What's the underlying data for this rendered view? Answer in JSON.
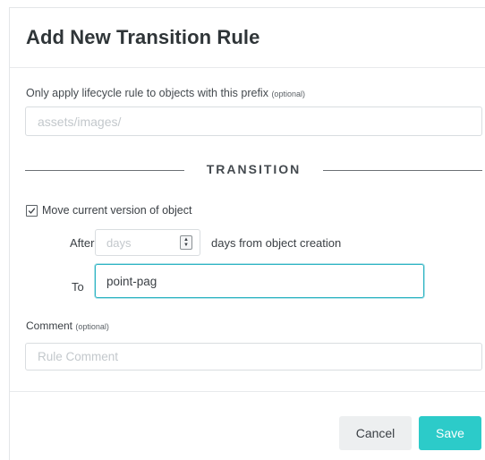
{
  "dialog": {
    "title": "Add New Transition Rule"
  },
  "prefix": {
    "label": "Only apply lifecycle rule to objects with this prefix",
    "optional_tag": "(optional)",
    "placeholder": "assets/images/",
    "value": ""
  },
  "section": {
    "transition_heading": "TRANSITION"
  },
  "move_current": {
    "checked": true,
    "label": "Move current version of object"
  },
  "after": {
    "label": "After",
    "placeholder": "days",
    "suffix": "days from object creation",
    "stepper_icon": "up-down-stepper-icon"
  },
  "to": {
    "label": "To",
    "value": "point-pag"
  },
  "comment": {
    "label": "Comment",
    "optional_tag": "(optional)",
    "placeholder": "Rule Comment"
  },
  "footer": {
    "cancel_label": "Cancel",
    "save_label": "Save"
  },
  "colors": {
    "accent": "#2ccbc9",
    "focus_border": "#2bb3c2",
    "cancel_bg": "#edeff0"
  }
}
